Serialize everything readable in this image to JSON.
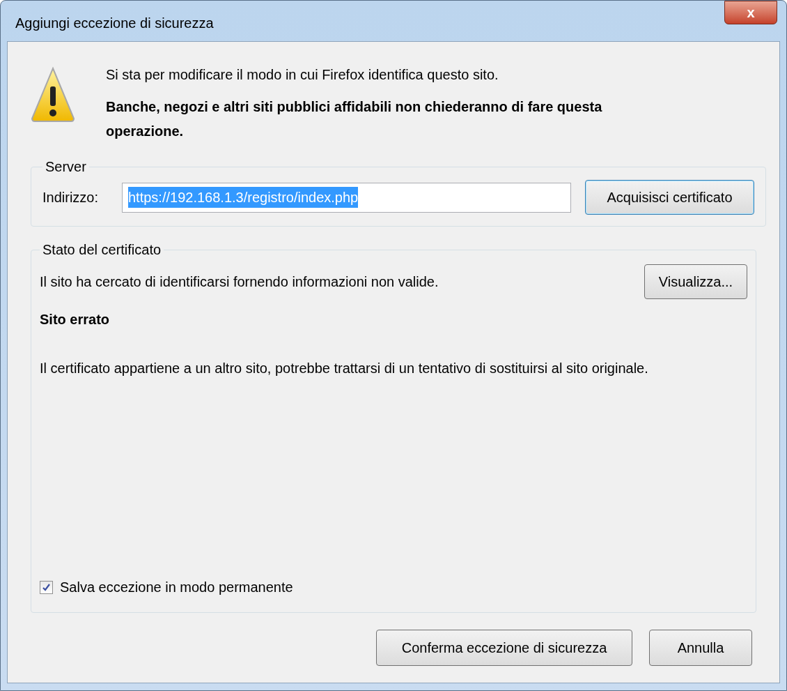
{
  "window": {
    "title": "Aggiungi eccezione di sicurezza",
    "close": "x"
  },
  "warning": {
    "message": "Si sta per modificare il modo in cui Firefox identifica questo sito.",
    "note": "Banche, negozi e altri siti pubblici affidabili non chiederanno di fare questa operazione."
  },
  "server": {
    "legend": "Server",
    "address_label": "Indirizzo:",
    "address": {
      "value": "https://192.168.1.3/registro/index.php",
      "selected": true
    },
    "button": {
      "label": "Acquisisci certificato",
      "focused": true
    }
  },
  "certificate_status": {
    "legend": "Stato del certificato",
    "summary": "Il sito ha cercato di identificarsi fornendo informazioni non valide.",
    "view_button": "Visualizza...",
    "problem_title": "Sito errato",
    "problem_text": "Il certificato appartiene a un altro sito, potrebbe trattarsi di un tentativo di sostituirsi al sito originale.",
    "permanent": {
      "label": "Salva eccezione in modo permanente",
      "checked": true
    }
  },
  "buttons": [
    {
      "label": "Conferma eccezione di sicurezza"
    },
    {
      "label": "Annulla"
    }
  ]
}
